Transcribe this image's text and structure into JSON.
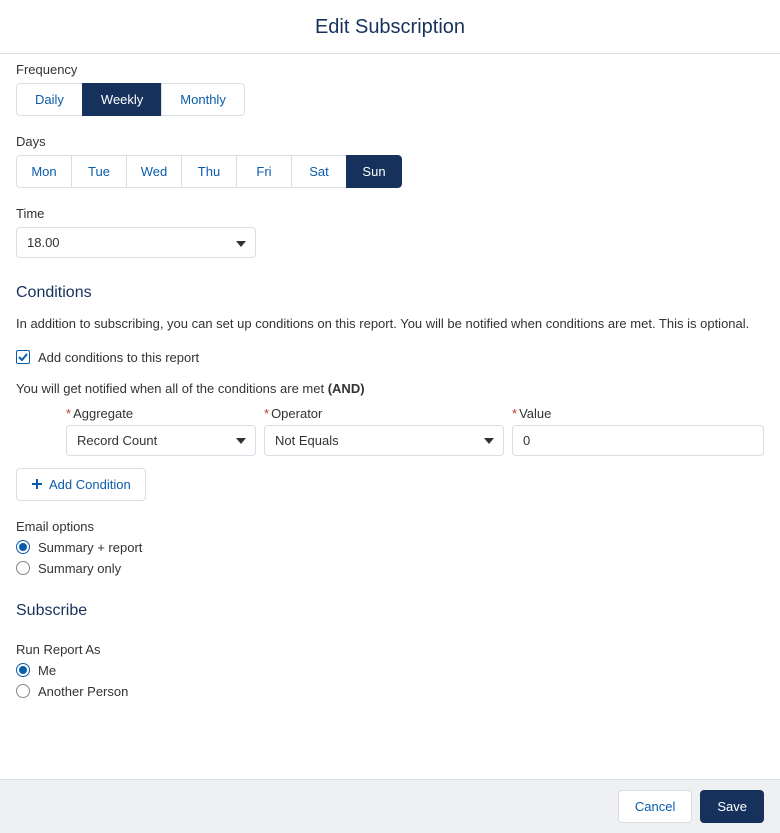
{
  "modal": {
    "title": "Edit Subscription"
  },
  "frequency": {
    "label": "Frequency",
    "options": [
      "Daily",
      "Weekly",
      "Monthly"
    ],
    "selected": "Weekly"
  },
  "days": {
    "label": "Days",
    "options": [
      "Mon",
      "Tue",
      "Wed",
      "Thu",
      "Fri",
      "Sat",
      "Sun"
    ],
    "selected": "Sun"
  },
  "time": {
    "label": "Time",
    "value": "18.00"
  },
  "conditions": {
    "heading": "Conditions",
    "help": "In addition to subscribing, you can set up conditions on this report. You will be notified when conditions are met. This is optional.",
    "checkbox_label": "Add conditions to this report",
    "checked": true,
    "notify_prefix": "You will get notified when all of the conditions are met ",
    "notify_bold": "(AND)",
    "aggregate_label": "Aggregate",
    "aggregate_value": "Record Count",
    "operator_label": "Operator",
    "operator_value": "Not Equals",
    "value_label": "Value",
    "value_value": "0",
    "add_button": "Add Condition"
  },
  "email": {
    "label": "Email options",
    "options": [
      "Summary + report",
      "Summary only"
    ],
    "selected": "Summary + report"
  },
  "subscribe": {
    "heading": "Subscribe",
    "run_label": "Run Report As",
    "options": [
      "Me",
      "Another Person"
    ],
    "selected": "Me"
  },
  "footer": {
    "cancel": "Cancel",
    "save": "Save"
  }
}
